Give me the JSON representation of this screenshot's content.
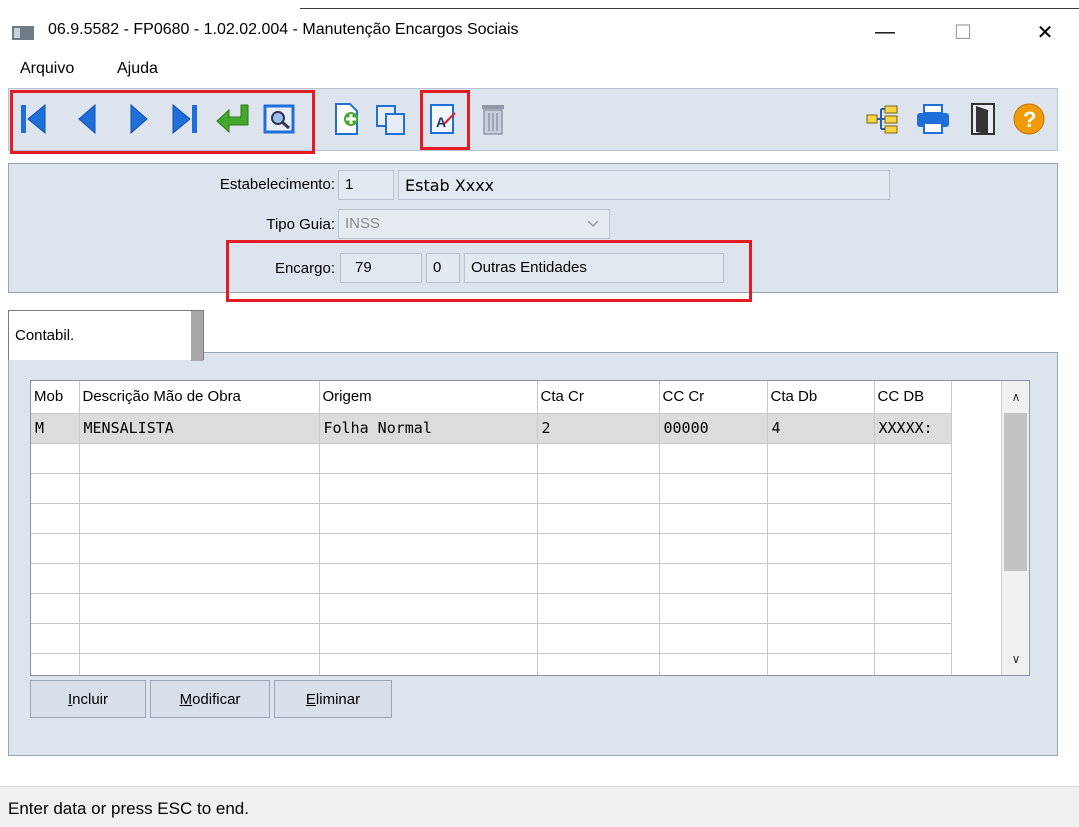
{
  "window": {
    "title": "06.9.5582 - FP0680 - 1.02.02.004 - Manutenção Encargos Sociais",
    "minimize": "—",
    "maximize": "☐",
    "close": "✕"
  },
  "menu": {
    "items": [
      "Arquivo",
      "Ajuda"
    ]
  },
  "toolbar": {
    "icons": [
      "first-record-icon",
      "previous-record-icon",
      "next-record-icon",
      "last-record-icon",
      "go-to-icon",
      "search-icon",
      "new-record-icon",
      "copy-icon",
      "edit-icon",
      "delete-icon",
      "tree-icon",
      "print-icon",
      "exit-icon",
      "help-icon"
    ],
    "help_glyph": "?",
    "edit_glyph": "A",
    "colors": {
      "nav_blue": "#1e6fd9",
      "green": "#45a72b",
      "red_highlight": "#e31b23",
      "help_orange": "#f29b0a"
    }
  },
  "form": {
    "estabelecimento_label": "Estabelecimento:",
    "estabelecimento_code": "1",
    "estabelecimento_name": "Estab Xxxx",
    "tipo_guia_label": "Tipo Guia:",
    "tipo_guia_value": "INSS",
    "encargo_label": "Encargo:",
    "encargo_code": "79",
    "encargo_seq": "0",
    "encargo_desc": "Outras Entidades"
  },
  "tabs": [
    {
      "label": "Contabil."
    }
  ],
  "grid": {
    "columns": [
      "Mob",
      "Descrição Mão de Obra",
      "Origem",
      "Cta Cr",
      "CC Cr",
      "Cta Db",
      "CC DB"
    ],
    "rows": [
      [
        "M",
        "MENSALISTA",
        "Folha Normal",
        "2",
        "00000",
        "4",
        "XXXXX:"
      ]
    ],
    "scroll_up": "∧",
    "scroll_down": "∨"
  },
  "buttons": {
    "incluir_u": "I",
    "incluir_rest": "ncluir",
    "modificar_u": "M",
    "modificar_rest": "odificar",
    "eliminar_u": "E",
    "eliminar_rest": "liminar"
  },
  "status": {
    "text": "Enter data or press ESC to end."
  }
}
